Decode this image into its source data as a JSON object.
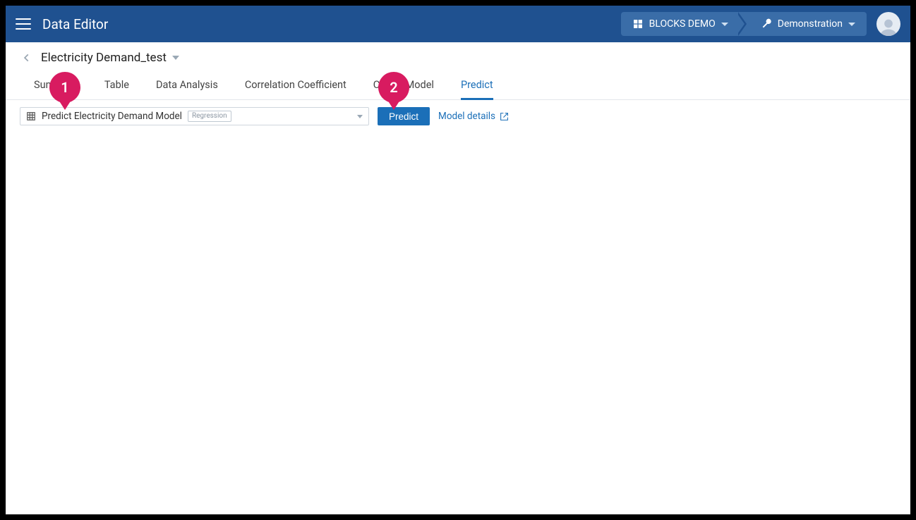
{
  "app": {
    "title": "Data Editor"
  },
  "breadcrumb_top": {
    "org": "BLOCKS DEMO",
    "project": "Demonstration"
  },
  "document": {
    "title": "Electricity Demand_test"
  },
  "tabs": [
    {
      "label": "Summary"
    },
    {
      "label": "Table"
    },
    {
      "label": "Data Analysis"
    },
    {
      "label": "Correlation Coefficient"
    },
    {
      "label": "Create Model"
    },
    {
      "label": "Predict",
      "active": true
    }
  ],
  "toolbar": {
    "model_selected": "Predict Electricity Demand Model",
    "model_tag": "Regression",
    "predict_label": "Predict",
    "model_details_label": "Model details"
  },
  "callouts": {
    "pin1": "1",
    "pin2": "2"
  }
}
